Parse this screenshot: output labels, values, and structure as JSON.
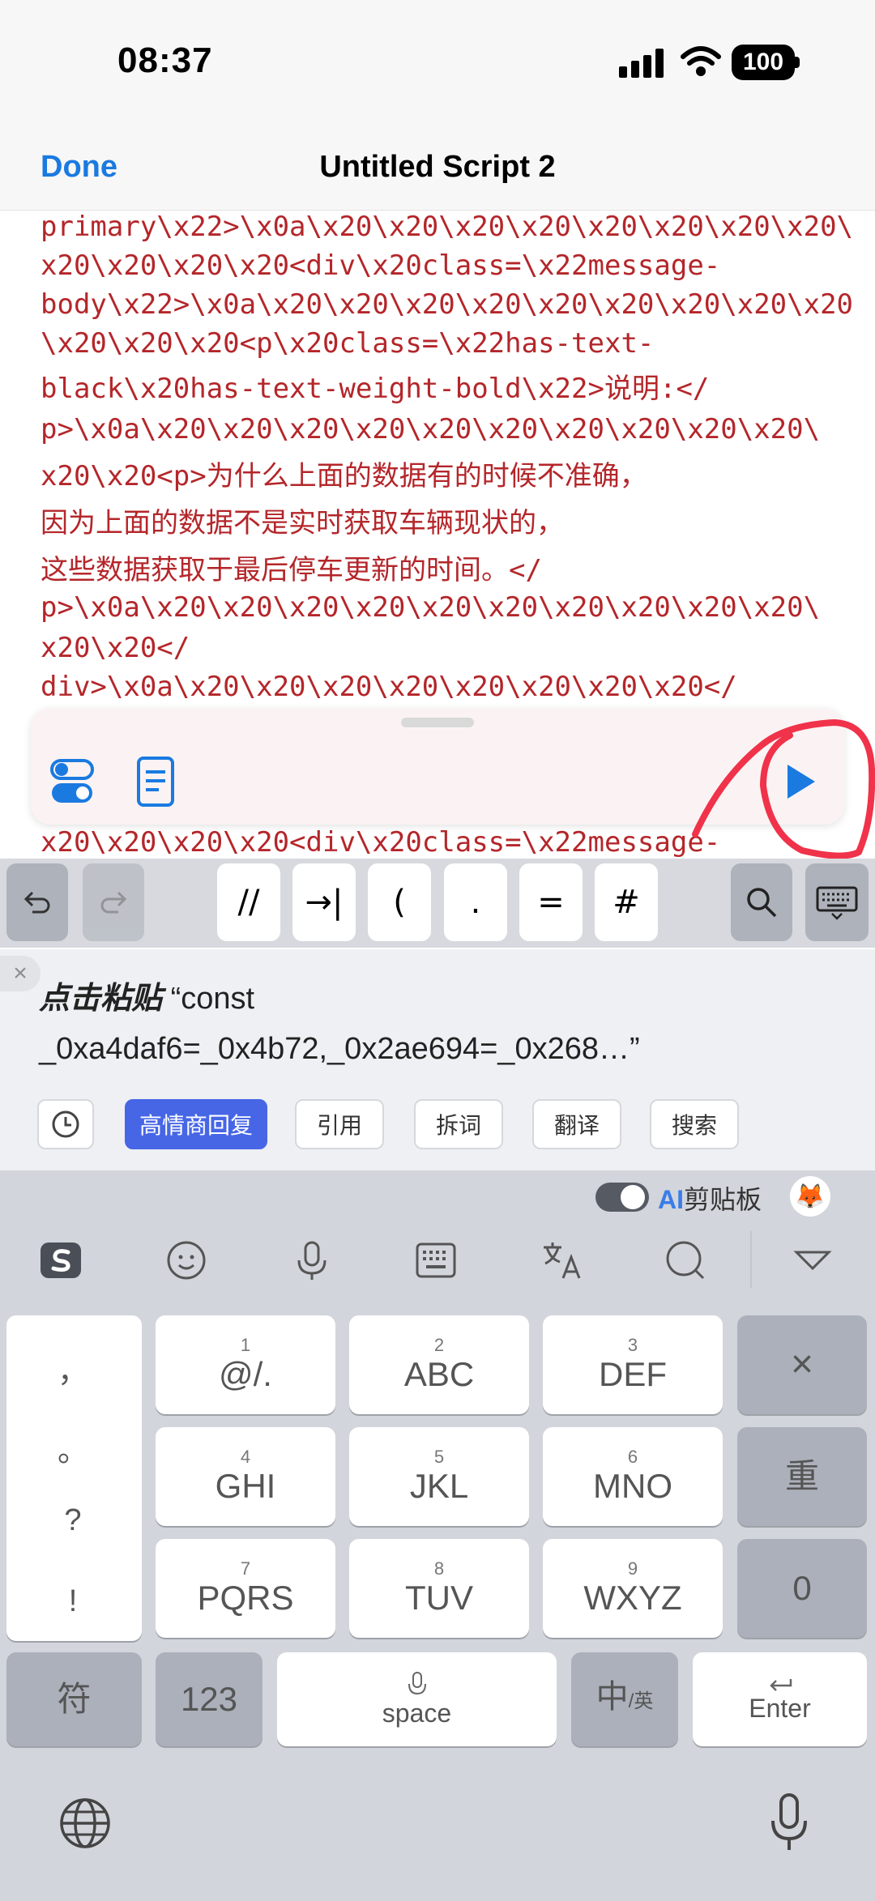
{
  "status": {
    "time": "08:37",
    "battery": "100"
  },
  "nav": {
    "done": "Done",
    "title": "Untitled Script 2"
  },
  "code_lines": [
    "primary\\x22>\\x0a\\x20\\x20\\x20\\x20\\x20\\x20\\x20\\x20\\",
    "x20\\x20\\x20\\x20<div\\x20class=\\x22message-",
    "body\\x22>\\x0a\\x20\\x20\\x20\\x20\\x20\\x20\\x20\\x20\\x20",
    "\\x20\\x20\\x20<p\\x20class=\\x22has-text-",
    "black\\x20has-text-weight-bold\\x22>说明:</",
    "p>\\x0a\\x20\\x20\\x20\\x20\\x20\\x20\\x20\\x20\\x20\\x20\\",
    "x20\\x20<p>为什么上面的数据有的时候不准确，",
    "因为上面的数据不是实时获取车辆现状的，",
    "这些数据获取于最后停车更新的时间。</",
    "p>\\x0a\\x20\\x20\\x20\\x20\\x20\\x20\\x20\\x20\\x20\\x20\\",
    "x20\\x20</",
    "div>\\x0a\\x20\\x20\\x20\\x20\\x20\\x20\\x20\\x20</"
  ],
  "code_below": "x20\\x20\\x20\\x20<div\\x20class=\\x22message-",
  "accessory_keys": [
    "//",
    "→|",
    "(",
    ".",
    "=",
    "#"
  ],
  "clipboard": {
    "close": "×",
    "prefix": "点击粘贴",
    "content": "“const _0xa4daf6=_0x4b72,_0x2ae694=_0x268…”"
  },
  "chips": [
    "高情商回复",
    "引用",
    "拆词",
    "翻译",
    "搜索"
  ],
  "ai_clipboard": {
    "ai": "AI",
    "label": "剪贴板"
  },
  "keys": {
    "row1": [
      {
        "num": "1",
        "label": "@/."
      },
      {
        "num": "2",
        "label": "ABC"
      },
      {
        "num": "3",
        "label": "DEF"
      }
    ],
    "row2": [
      {
        "num": "4",
        "label": "GHI"
      },
      {
        "num": "5",
        "label": "JKL"
      },
      {
        "num": "6",
        "label": "MNO"
      }
    ],
    "row3": [
      {
        "num": "7",
        "label": "PQRS"
      },
      {
        "num": "8",
        "label": "TUV"
      },
      {
        "num": "9",
        "label": "WXYZ"
      }
    ],
    "punct": [
      "，",
      "。",
      "?",
      "!"
    ],
    "delete": "×",
    "redo": "重",
    "zero": "0",
    "symbol": "符",
    "num123": "123",
    "space": "space",
    "lang_main": "中",
    "lang_sub": "/英",
    "enter": "Enter"
  },
  "colors": {
    "accent": "#1a7ae0",
    "code": "#b4262a",
    "annotation": "#f0324a",
    "chip_active": "#4766e6"
  }
}
